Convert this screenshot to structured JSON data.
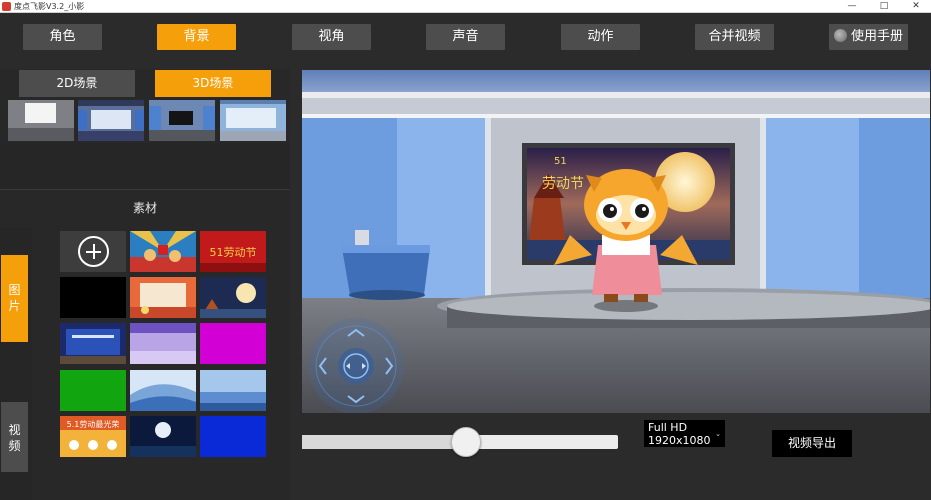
{
  "window": {
    "title": "度点飞影V3.2_小影",
    "minimize": "—",
    "maximize": "□",
    "close": "✕"
  },
  "menu": {
    "items": [
      "角色",
      "背景",
      "视角",
      "声音",
      "动作",
      "合并视频"
    ],
    "active": "背景",
    "manual": "使用手册",
    "manual_icon": "globe-icon"
  },
  "scene_tabs": {
    "tab_2d": "2D场景",
    "tab_3d": "3D场景",
    "active": "3D场景"
  },
  "assets": {
    "title": "素材",
    "side_tabs": [
      "图片",
      "视频"
    ],
    "active_side_tab": "图片"
  },
  "preview": {
    "screen_text_top": "51",
    "screen_text_main": "劳动节",
    "thumb_text_1": "51劳动节",
    "thumb_text_2": "5.1劳动最光荣"
  },
  "controls": {
    "slider_value_percent": 52,
    "resolution_line1": "Full HD",
    "resolution_line2": "1920x1080",
    "export_label": "视频导出"
  },
  "colors": {
    "accent": "#f5a00a",
    "button": "#4d4d4d",
    "background": "#2b2b2b"
  }
}
